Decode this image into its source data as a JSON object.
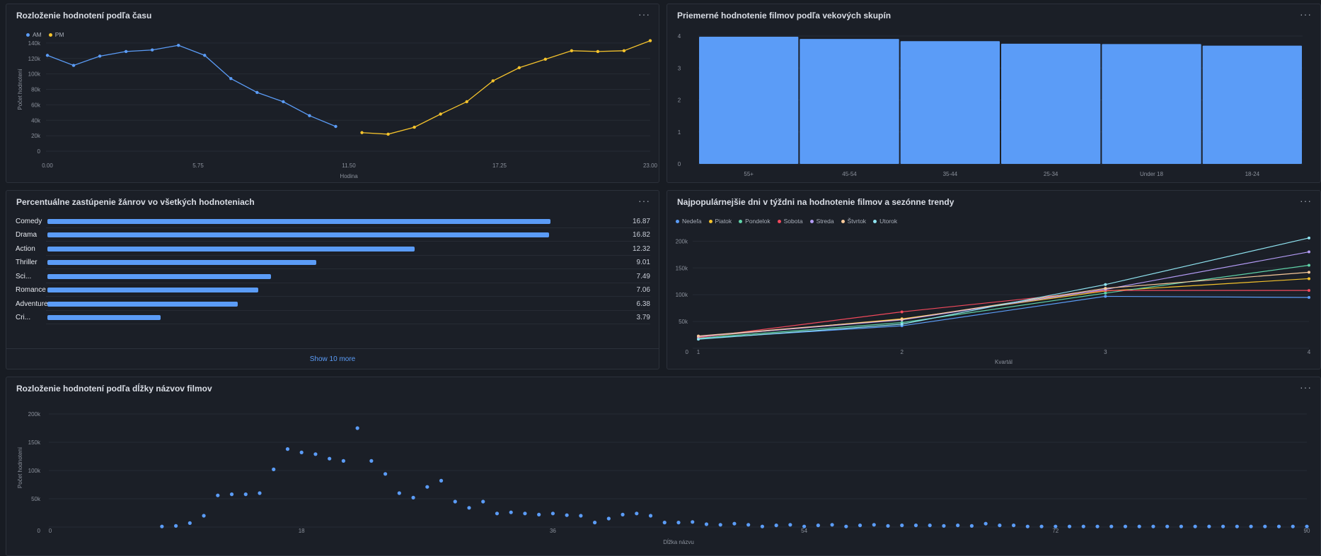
{
  "colors": {
    "am": "#5b9cf7",
    "pm": "#f5c32c",
    "bar": "#5b9cf7",
    "grid": "#262b34",
    "axis_text": "#8b919c"
  },
  "panels": {
    "time": {
      "title": "Rozloženie hodnotení podľa času",
      "menu": "···",
      "chart_data": {
        "type": "line",
        "xlabel": "Hodina",
        "ylabel": "Počet hodnotení",
        "x_ticks": [
          "0.00",
          "5.75",
          "11.50",
          "17.25",
          "23.00"
        ],
        "y_ticks": [
          "0",
          "20k",
          "40k",
          "60k",
          "80k",
          "100k",
          "120k",
          "140k"
        ],
        "xlim": [
          0,
          23
        ],
        "ylim": [
          0,
          160000
        ],
        "series": [
          {
            "name": "AM",
            "color": "#5b9cf7",
            "x": [
              0,
              1,
              2,
              3,
              4,
              5,
              6,
              7,
              8,
              9,
              10,
              11
            ],
            "y": [
              124000,
              111000,
              123000,
              129000,
              131000,
              137000,
              124000,
              94000,
              76000,
              64000,
              46000,
              32000
            ]
          },
          {
            "name": "PM",
            "color": "#f5c32c",
            "x": [
              12,
              13,
              14,
              15,
              16,
              17,
              18,
              19,
              20,
              21,
              22,
              23
            ],
            "y": [
              24000,
              22000,
              31000,
              48000,
              64000,
              91000,
              108000,
              119000,
              130000,
              129000,
              130000,
              143000
            ]
          }
        ]
      }
    },
    "age": {
      "title": "Priemerné hodnotenie filmov podľa vekových skupín",
      "menu": "···",
      "chart_data": {
        "type": "bar",
        "categories": [
          "55+",
          "45-54",
          "35-44",
          "25-34",
          "Under 18",
          "18-24"
        ],
        "values": [
          3.98,
          3.91,
          3.84,
          3.76,
          3.75,
          3.7
        ],
        "y_ticks": [
          "0",
          "1",
          "2",
          "3",
          "4"
        ],
        "ylim": [
          0,
          4.2
        ]
      }
    },
    "genres": {
      "title": "Percentuálne zastúpenie žánrov vo všetkých hodnoteniach",
      "menu": "···",
      "items": [
        {
          "label": "Comedy",
          "value": 16.87,
          "display": "16.87"
        },
        {
          "label": "Drama",
          "value": 16.82,
          "display": "16.82"
        },
        {
          "label": "Action",
          "value": 12.32,
          "display": "12.32"
        },
        {
          "label": "Thriller",
          "value": 9.01,
          "display": "9.01"
        },
        {
          "label": "Sci...",
          "value": 7.49,
          "display": "7.49"
        },
        {
          "label": "Romance",
          "value": 7.06,
          "display": "7.06"
        },
        {
          "label": "Adventure",
          "value": 6.38,
          "display": "6.38"
        },
        {
          "label": "Cri...",
          "value": 3.79,
          "display": "3.79"
        }
      ],
      "show_more": "Show 10 more"
    },
    "weekdays": {
      "title": "Najpopulárnejšie dni v týždni na hodnotenie filmov a sezónne trendy",
      "menu": "···",
      "chart_data": {
        "type": "line",
        "xlabel": "Kvartál",
        "x": [
          1,
          2,
          3,
          4
        ],
        "x_ticks": [
          "1",
          "2",
          "3",
          "4"
        ],
        "y_ticks": [
          "0",
          "50k",
          "100k",
          "150k",
          "200k"
        ],
        "ylim": [
          0,
          215000
        ],
        "series": [
          {
            "name": "Nedeľa",
            "color": "#5b9cf7",
            "y": [
              18000,
              42000,
              97000,
              95000
            ]
          },
          {
            "name": "Piatok",
            "color": "#f5c32c",
            "y": [
              21000,
              55000,
              107000,
              130000
            ]
          },
          {
            "name": "Pondelok",
            "color": "#5fd3a8",
            "y": [
              19000,
              48000,
              103000,
              155000
            ]
          },
          {
            "name": "Sobota",
            "color": "#f2495c",
            "y": [
              20000,
              68000,
              108000,
              108000
            ]
          },
          {
            "name": "Streda",
            "color": "#b39bf5",
            "y": [
              22000,
              53000,
              110000,
              180000
            ]
          },
          {
            "name": "Štvrtok",
            "color": "#f8c99a",
            "y": [
              23000,
              54000,
              112000,
              142000
            ]
          },
          {
            "name": "Utorok",
            "color": "#8fe3f0",
            "y": [
              17000,
              45000,
              119000,
              206000
            ]
          }
        ]
      }
    },
    "title_length": {
      "title": "Rozloženie hodnotení podľa dĺžky názvov filmov",
      "menu": "···",
      "chart_data": {
        "type": "scatter",
        "xlabel": "Dĺžka názvu",
        "ylabel": "Počet hodnotení",
        "x_ticks": [
          "0",
          "18",
          "36",
          "54",
          "72",
          "90"
        ],
        "y_ticks": [
          "0",
          "50k",
          "100k",
          "150k",
          "200k"
        ],
        "xlim": [
          0,
          90
        ],
        "ylim": [
          0,
          210000
        ],
        "x": [
          8,
          9,
          10,
          11,
          12,
          13,
          14,
          15,
          16,
          17,
          18,
          19,
          20,
          21,
          22,
          23,
          24,
          25,
          26,
          27,
          28,
          29,
          30,
          31,
          32,
          33,
          34,
          35,
          36,
          37,
          38,
          39,
          40,
          41,
          42,
          43,
          44,
          45,
          46,
          47,
          48,
          49,
          50,
          51,
          52,
          53,
          54,
          55,
          56,
          57,
          58,
          59,
          60,
          61,
          62,
          63,
          64,
          65,
          66,
          67,
          68,
          69,
          70,
          71,
          72,
          73,
          74,
          75,
          76,
          77,
          78,
          79,
          80,
          81,
          82,
          83,
          84,
          85,
          86,
          87,
          88,
          89,
          90
        ],
        "y": [
          1000,
          2000,
          7000,
          20000,
          56000,
          58000,
          58000,
          60000,
          102000,
          138000,
          132000,
          129000,
          121000,
          117000,
          175000,
          117000,
          94000,
          60000,
          52000,
          71000,
          82000,
          45000,
          34000,
          45000,
          24000,
          26000,
          24000,
          22000,
          24000,
          21000,
          20000,
          8000,
          15000,
          22000,
          24000,
          20000,
          8000,
          8000,
          9000,
          5000,
          4000,
          6000,
          4000,
          1000,
          3000,
          4000,
          1000,
          3000,
          4000,
          1000,
          3000,
          4000,
          2000,
          3000,
          3000,
          3000,
          2000,
          3000,
          2000,
          6000,
          3000,
          3000,
          1000,
          1000,
          1000,
          1000,
          1000,
          1000,
          1000,
          1000,
          1000,
          1000,
          1000,
          1000,
          1000,
          1000,
          1000,
          1000,
          1000,
          1000,
          1000,
          1000,
          1000
        ]
      }
    }
  }
}
